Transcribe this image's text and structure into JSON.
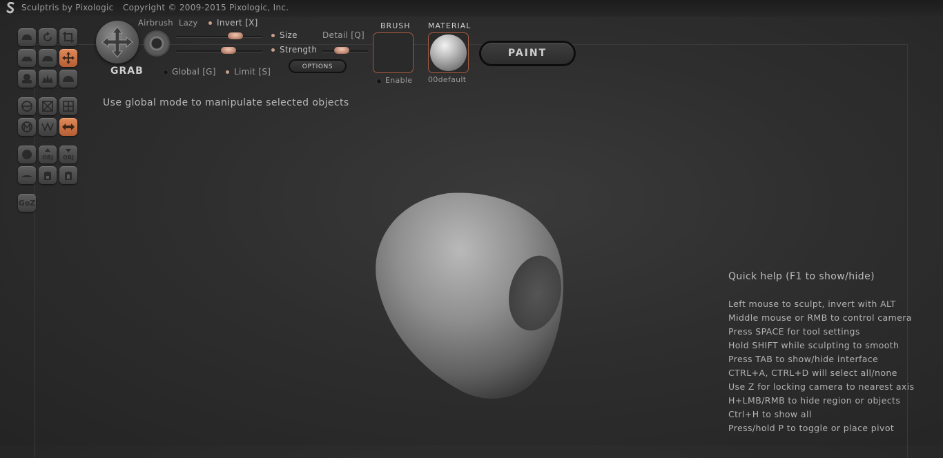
{
  "titlebar": {
    "app_name": "Sculptris by Pixologic",
    "copyright": "Copyright © 2009-2015 Pixologic, Inc."
  },
  "tool_panel": {
    "current_tool": "GRAB",
    "airbrush_label": "Airbrush",
    "lazy_label": "Lazy",
    "invert_label": "Invert [X]",
    "size_label": "Size",
    "strength_label": "Strength",
    "detail_label": "Detail [Q]",
    "global_label": "Global [G]",
    "limit_label": "Limit [S]",
    "options_label": "OPTIONS",
    "brush_title": "BRUSH",
    "brush_enable_label": "Enable",
    "material_title": "MATERIAL",
    "material_name": "00default",
    "paint_label": "PAINT"
  },
  "toolbar": {
    "goz_label": "GoZ",
    "obj_label": "OBJ",
    "active_color": "#c8693e"
  },
  "status_message": "Use global mode to manipulate selected objects",
  "quick_help": {
    "title": "Quick help (F1 to show/hide)",
    "lines": [
      "Left mouse to sculpt, invert with ALT",
      "Middle mouse or RMB to control camera",
      "Press SPACE for tool settings",
      "Hold SHIFT while sculpting to smooth",
      "Press TAB to show/hide interface",
      "CTRL+A, CTRL+D will select all/none",
      "Use Z for locking camera to nearest axis",
      "H+LMB/RMB to hide region or objects",
      "Ctrl+H to show all",
      "Press/hold P to toggle or place pivot"
    ]
  }
}
